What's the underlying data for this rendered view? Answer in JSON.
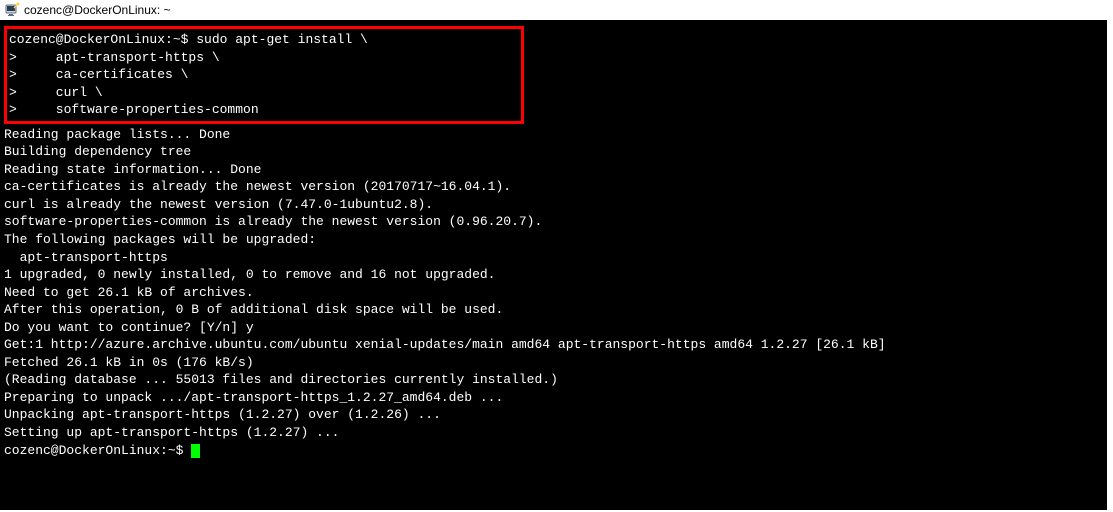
{
  "titlebar": {
    "text": "cozenc@DockerOnLinux: ~"
  },
  "terminal": {
    "highlighted": {
      "line0": "cozenc@DockerOnLinux:~$ sudo apt-get install \\",
      "line1": ">     apt-transport-https \\",
      "line2": ">     ca-certificates \\",
      "line3": ">     curl \\",
      "line4": ">     software-properties-common"
    },
    "body": {
      "line0": "Reading package lists... Done",
      "line1": "Building dependency tree",
      "line2": "Reading state information... Done",
      "line3": "ca-certificates is already the newest version (20170717~16.04.1).",
      "line4": "curl is already the newest version (7.47.0-1ubuntu2.8).",
      "line5": "software-properties-common is already the newest version (0.96.20.7).",
      "line6": "The following packages will be upgraded:",
      "line7": "  apt-transport-https",
      "line8": "1 upgraded, 0 newly installed, 0 to remove and 16 not upgraded.",
      "line9": "Need to get 26.1 kB of archives.",
      "line10": "After this operation, 0 B of additional disk space will be used.",
      "line11": "Do you want to continue? [Y/n] y",
      "line12": "Get:1 http://azure.archive.ubuntu.com/ubuntu xenial-updates/main amd64 apt-transport-https amd64 1.2.27 [26.1 kB]",
      "line13": "Fetched 26.1 kB in 0s (176 kB/s)",
      "line14": "(Reading database ... 55013 files and directories currently installed.)",
      "line15": "Preparing to unpack .../apt-transport-https_1.2.27_amd64.deb ...",
      "line16": "Unpacking apt-transport-https (1.2.27) over (1.2.26) ...",
      "line17": "Setting up apt-transport-https (1.2.27) ...",
      "line18": "cozenc@DockerOnLinux:~$ "
    }
  }
}
